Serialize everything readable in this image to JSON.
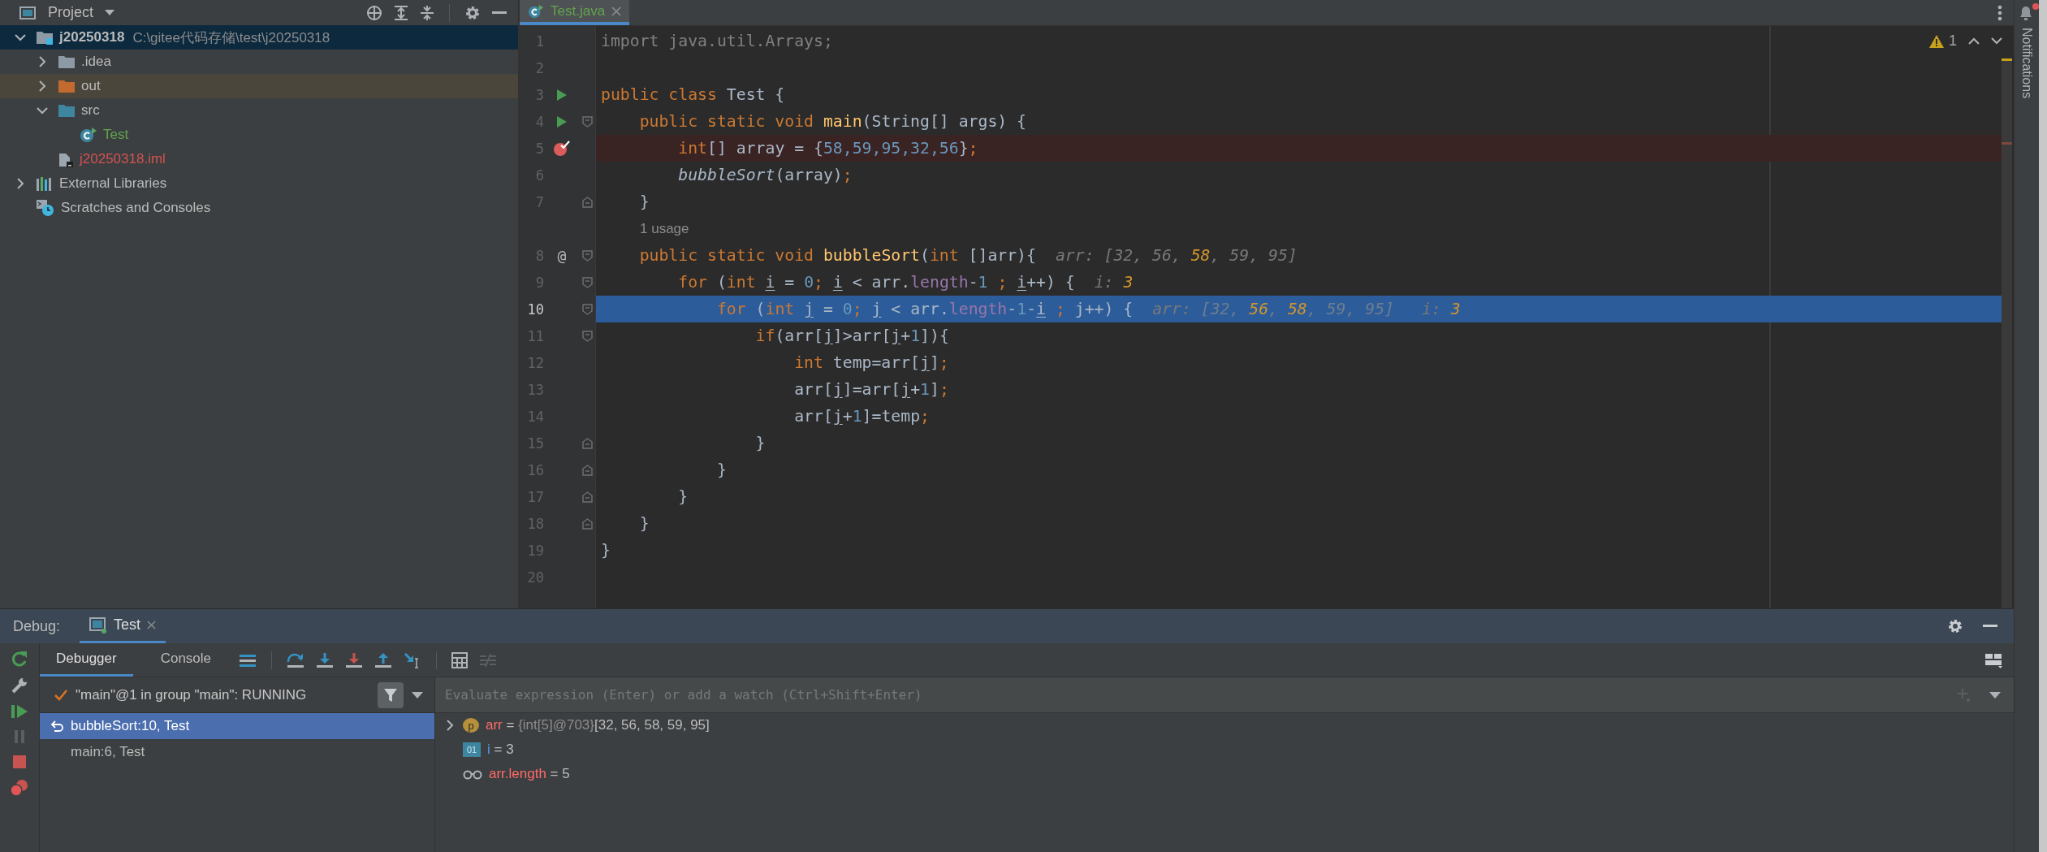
{
  "project_panel": {
    "title": "Project",
    "tree": [
      {
        "name": "j20250318",
        "path": "C:\\gitee代码存储\\test\\j20250318",
        "kind": "module",
        "expanded": true,
        "selected": true,
        "highlighted": false,
        "color": "#bbbbbb",
        "children": [
          {
            "name": ".idea",
            "kind": "folder",
            "expanded": false,
            "selected": false,
            "highlighted": false,
            "color": "#bbbbbb"
          },
          {
            "name": "out",
            "kind": "excluded",
            "expanded": false,
            "selected": false,
            "highlighted": true,
            "color": "#bbbbbb"
          },
          {
            "name": "src",
            "kind": "source",
            "expanded": true,
            "selected": false,
            "highlighted": false,
            "color": "#bbbbbb",
            "children": [
              {
                "name": "Test",
                "kind": "class",
                "selected": false,
                "highlighted": false,
                "color": "#62a44e"
              }
            ]
          },
          {
            "name": "j20250318.iml",
            "kind": "file",
            "selected": false,
            "highlighted": false,
            "color": "#d25252"
          }
        ]
      },
      {
        "name": "External Libraries",
        "kind": "libraries",
        "expanded": false,
        "selected": false,
        "highlighted": false,
        "color": "#bbbbbb"
      },
      {
        "name": "Scratches and Consoles",
        "kind": "scratches",
        "selected": false,
        "highlighted": false,
        "color": "#bbbbbb"
      }
    ]
  },
  "editor": {
    "tab": {
      "label": "Test.java",
      "selected": true
    },
    "warnings": "1",
    "lines": [
      {
        "kind": "code",
        "number": "1",
        "runnable": false,
        "breakpoint": false,
        "current": false,
        "fold_start": false,
        "fold_end": false,
        "tokens": [
          {
            "text": "import java.util.Arrays;",
            "kind": "unused"
          }
        ]
      },
      {
        "kind": "code",
        "number": "2",
        "runnable": false,
        "breakpoint": false,
        "current": false,
        "fold_start": false,
        "fold_end": false
      },
      {
        "kind": "code",
        "number": "3",
        "runnable": true,
        "breakpoint": false,
        "current": false,
        "fold_start": false,
        "fold_end": false,
        "tokens": [
          {
            "text": "public class ",
            "kind": "keyword"
          },
          {
            "text": "Test {",
            "kind": "plain"
          }
        ]
      },
      {
        "kind": "code",
        "number": "4",
        "runnable": true,
        "breakpoint": false,
        "current": false,
        "fold_start": true,
        "fold_end": false,
        "tokens": [
          {
            "text": "    public static void ",
            "kind": "keyword"
          },
          {
            "text": "main",
            "kind": "method"
          },
          {
            "text": "(String[] args) {",
            "kind": "plain"
          }
        ]
      },
      {
        "kind": "code",
        "number": "5",
        "runnable": false,
        "breakpoint": true,
        "current": false,
        "fold_start": false,
        "fold_end": false,
        "tokens": [
          {
            "text": "        int",
            "kind": "keyword"
          },
          {
            "text": "[] array = {",
            "kind": "plain"
          },
          {
            "text": "58,59,95,32,56",
            "kind": "number"
          },
          {
            "text": "}",
            "kind": "plain"
          },
          {
            "text": ";",
            "kind": "keyword"
          }
        ]
      },
      {
        "kind": "code",
        "number": "6",
        "runnable": false,
        "breakpoint": false,
        "current": false,
        "fold_start": false,
        "fold_end": false,
        "tokens": [
          {
            "text": "        bubbleSort",
            "kind": "call"
          },
          {
            "text": "(array)",
            "kind": "plain"
          },
          {
            "text": ";",
            "kind": "keyword"
          }
        ]
      },
      {
        "kind": "code",
        "number": "7",
        "runnable": false,
        "breakpoint": false,
        "current": false,
        "fold_start": false,
        "fold_end": true,
        "tokens": [
          {
            "text": "    }",
            "kind": "plain"
          }
        ]
      },
      {
        "kind": "inlay",
        "text": "1 usage"
      },
      {
        "kind": "code",
        "number": "8",
        "runnable": false,
        "breakpoint": false,
        "current": false,
        "fold_start": true,
        "fold_end": false,
        "gutter_text": "@",
        "tokens": [
          {
            "text": "    public static void ",
            "kind": "keyword"
          },
          {
            "text": "bubbleSort",
            "kind": "method"
          },
          {
            "text": "(",
            "kind": "plain"
          },
          {
            "text": "int ",
            "kind": "keyword"
          },
          {
            "text": "[]arr){",
            "kind": "plain"
          }
        ],
        "hints": [
          [
            {
              "text": "arr: [32, 56, ",
              "kind": "label"
            },
            {
              "text": "58",
              "kind": "changed"
            },
            {
              "text": ", 59, 95]",
              "kind": "label"
            }
          ]
        ]
      },
      {
        "kind": "code",
        "number": "9",
        "runnable": false,
        "breakpoint": false,
        "current": false,
        "fold_start": true,
        "fold_end": false,
        "tokens": [
          {
            "text": "        for ",
            "kind": "keyword"
          },
          {
            "text": "(",
            "kind": "plain"
          },
          {
            "text": "int ",
            "kind": "keyword"
          },
          {
            "text": "i",
            "kind": "variable"
          },
          {
            "text": " = ",
            "kind": "plain"
          },
          {
            "text": "0",
            "kind": "number"
          },
          {
            "text": "; ",
            "kind": "keyword"
          },
          {
            "text": "i",
            "kind": "variable"
          },
          {
            "text": " < arr.",
            "kind": "plain"
          },
          {
            "text": "length",
            "kind": "field"
          },
          {
            "text": "-",
            "kind": "plain"
          },
          {
            "text": "1",
            "kind": "number"
          },
          {
            "text": " ; ",
            "kind": "keyword"
          },
          {
            "text": "i",
            "kind": "variable"
          },
          {
            "text": "++) {",
            "kind": "plain"
          }
        ],
        "hints": [
          [
            {
              "text": "i: ",
              "kind": "label"
            },
            {
              "text": "3",
              "kind": "changed"
            }
          ]
        ]
      },
      {
        "kind": "code",
        "number": "10",
        "runnable": false,
        "breakpoint": false,
        "current": true,
        "fold_start": true,
        "fold_end": false,
        "tokens": [
          {
            "text": "            for ",
            "kind": "keyword"
          },
          {
            "text": "(",
            "kind": "plain"
          },
          {
            "text": "int ",
            "kind": "keyword"
          },
          {
            "text": "j",
            "kind": "variable"
          },
          {
            "text": " = ",
            "kind": "plain"
          },
          {
            "text": "0",
            "kind": "number"
          },
          {
            "text": "; ",
            "kind": "keyword"
          },
          {
            "text": "j",
            "kind": "variable"
          },
          {
            "text": " < arr.",
            "kind": "plain"
          },
          {
            "text": "length",
            "kind": "field"
          },
          {
            "text": "-",
            "kind": "plain"
          },
          {
            "text": "1",
            "kind": "number"
          },
          {
            "text": "-",
            "kind": "plain"
          },
          {
            "text": "i",
            "kind": "variable"
          },
          {
            "text": " ; ",
            "kind": "keyword"
          },
          {
            "text": "j++) {",
            "kind": "plain"
          }
        ],
        "hints": [
          [
            {
              "text": "arr: ",
              "kind": "label"
            },
            {
              "text": "[32, ",
              "kind": "faded"
            },
            {
              "text": "56",
              "kind": "changed"
            },
            {
              "text": ", ",
              "kind": "faded"
            },
            {
              "text": "58",
              "kind": "changed"
            },
            {
              "text": ", 59, 95]",
              "kind": "faded"
            }
          ],
          [
            {
              "text": "i: ",
              "kind": "label"
            },
            {
              "text": "3",
              "kind": "changed"
            }
          ]
        ]
      },
      {
        "kind": "code",
        "number": "11",
        "runnable": false,
        "breakpoint": false,
        "current": false,
        "fold_start": true,
        "fold_end": false,
        "tokens": [
          {
            "text": "                if",
            "kind": "keyword"
          },
          {
            "text": "(arr[",
            "kind": "plain"
          },
          {
            "text": "j",
            "kind": "variable"
          },
          {
            "text": "]>arr[",
            "kind": "plain"
          },
          {
            "text": "j",
            "kind": "variable"
          },
          {
            "text": "+",
            "kind": "plain"
          },
          {
            "text": "1",
            "kind": "number"
          },
          {
            "text": "]){",
            "kind": "plain"
          }
        ]
      },
      {
        "kind": "code",
        "number": "12",
        "runnable": false,
        "breakpoint": false,
        "current": false,
        "fold_start": false,
        "fold_end": false,
        "tokens": [
          {
            "text": "                    int ",
            "kind": "keyword"
          },
          {
            "text": "temp=arr[",
            "kind": "plain"
          },
          {
            "text": "j",
            "kind": "variable"
          },
          {
            "text": "]",
            "kind": "plain"
          },
          {
            "text": ";",
            "kind": "keyword"
          }
        ]
      },
      {
        "kind": "code",
        "number": "13",
        "runnable": false,
        "breakpoint": false,
        "current": false,
        "fold_start": false,
        "fold_end": false,
        "tokens": [
          {
            "text": "                    arr[",
            "kind": "plain"
          },
          {
            "text": "j",
            "kind": "variable"
          },
          {
            "text": "]=arr[",
            "kind": "plain"
          },
          {
            "text": "j",
            "kind": "variable"
          },
          {
            "text": "+",
            "kind": "plain"
          },
          {
            "text": "1",
            "kind": "number"
          },
          {
            "text": "]",
            "kind": "plain"
          },
          {
            "text": ";",
            "kind": "keyword"
          }
        ]
      },
      {
        "kind": "code",
        "number": "14",
        "runnable": false,
        "breakpoint": false,
        "current": false,
        "fold_start": false,
        "fold_end": false,
        "tokens": [
          {
            "text": "                    arr[",
            "kind": "plain"
          },
          {
            "text": "j",
            "kind": "variable"
          },
          {
            "text": "+",
            "kind": "plain"
          },
          {
            "text": "1",
            "kind": "number"
          },
          {
            "text": "]=temp",
            "kind": "plain"
          },
          {
            "text": ";",
            "kind": "keyword"
          }
        ]
      },
      {
        "kind": "code",
        "number": "15",
        "runnable": false,
        "breakpoint": false,
        "current": false,
        "fold_start": false,
        "fold_end": true,
        "tokens": [
          {
            "text": "                }",
            "kind": "plain"
          }
        ]
      },
      {
        "kind": "code",
        "number": "16",
        "runnable": false,
        "breakpoint": false,
        "current": false,
        "fold_start": false,
        "fold_end": true,
        "tokens": [
          {
            "text": "            }",
            "kind": "plain"
          }
        ]
      },
      {
        "kind": "code",
        "number": "17",
        "runnable": false,
        "breakpoint": false,
        "current": false,
        "fold_start": false,
        "fold_end": true,
        "tokens": [
          {
            "text": "        }",
            "kind": "plain"
          }
        ]
      },
      {
        "kind": "code",
        "number": "18",
        "runnable": false,
        "breakpoint": false,
        "current": false,
        "fold_start": false,
        "fold_end": true,
        "tokens": [
          {
            "text": "    }",
            "kind": "plain"
          }
        ]
      },
      {
        "kind": "code",
        "number": "19",
        "runnable": false,
        "breakpoint": false,
        "current": false,
        "fold_start": false,
        "fold_end": false,
        "tokens": [
          {
            "text": "}",
            "kind": "plain"
          }
        ]
      },
      {
        "kind": "code",
        "number": "20",
        "runnable": false,
        "breakpoint": false,
        "current": false,
        "fold_start": false,
        "fold_end": false
      }
    ]
  },
  "debug": {
    "title": "Debug:",
    "tab": {
      "label": "Test"
    },
    "tabs": [
      {
        "label": "Debugger",
        "selected": true
      },
      {
        "label": "Console",
        "selected": false
      }
    ],
    "thread": "\"main\"@1 in group \"main\": RUNNING",
    "frames": [
      {
        "label": "bubbleSort:10, Test",
        "selected": true
      },
      {
        "label": "main:6, Test",
        "selected": false
      }
    ],
    "evaluate": {
      "placeholder": "Evaluate expression (Enter) or add a watch (Ctrl+Shift+Enter)"
    },
    "variables": [
      {
        "kind": "param",
        "badge": "p",
        "name": "arr",
        "eq": "=",
        "ref": "{int[5]@703}",
        "value": "[32, 56, 58, 59, 95]",
        "expanded": false
      },
      {
        "kind": "local",
        "badge": "01",
        "name": "i",
        "eq": "=",
        "value": "3"
      },
      {
        "kind": "watch",
        "name": "arr.length",
        "eq": "=",
        "value": "5"
      }
    ]
  },
  "right_strip": {
    "label": "Notifications",
    "unread": true
  }
}
